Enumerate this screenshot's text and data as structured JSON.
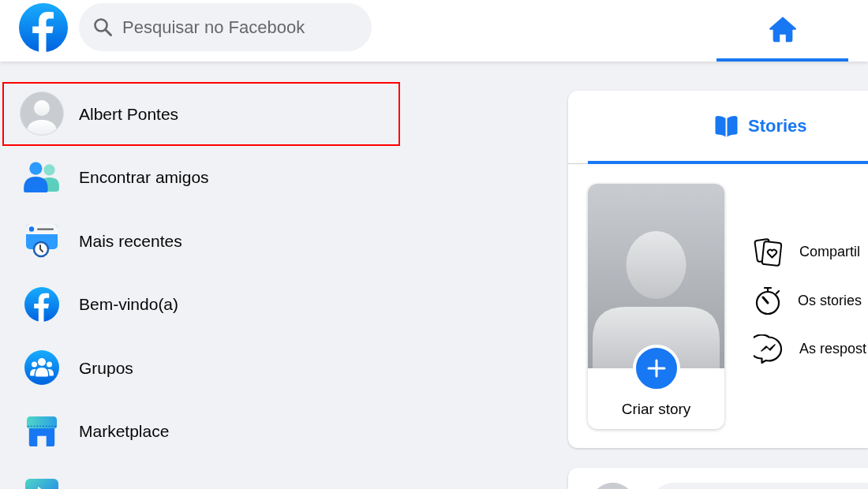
{
  "header": {
    "search": {
      "placeholder": "Pesquisar no Facebook"
    },
    "nav_tabs": [
      {
        "selected": true
      }
    ]
  },
  "sidebar": {
    "items": [
      {
        "kind": "profile",
        "label": "Albert Pontes",
        "highlighted": true
      },
      {
        "kind": "shortcut",
        "label": "Encontrar amigos",
        "highlighted": false
      },
      {
        "kind": "shortcut",
        "label": "Mais recentes",
        "highlighted": false
      },
      {
        "kind": "shortcut",
        "label": "Bem-vindo(a)",
        "highlighted": false
      },
      {
        "kind": "shortcut",
        "label": "Grupos",
        "highlighted": false
      },
      {
        "kind": "shortcut",
        "label": "Marketplace",
        "highlighted": false
      },
      {
        "kind": "shortcut",
        "highlighted": false
      }
    ]
  },
  "stories": {
    "tabs": [
      {
        "label": "Stories",
        "selected": true
      }
    ],
    "create_story": {
      "label": "Criar story"
    },
    "tips": [
      {
        "text": "Compartil"
      },
      {
        "text": "Os stories"
      },
      {
        "text": "As respost"
      }
    ]
  }
}
